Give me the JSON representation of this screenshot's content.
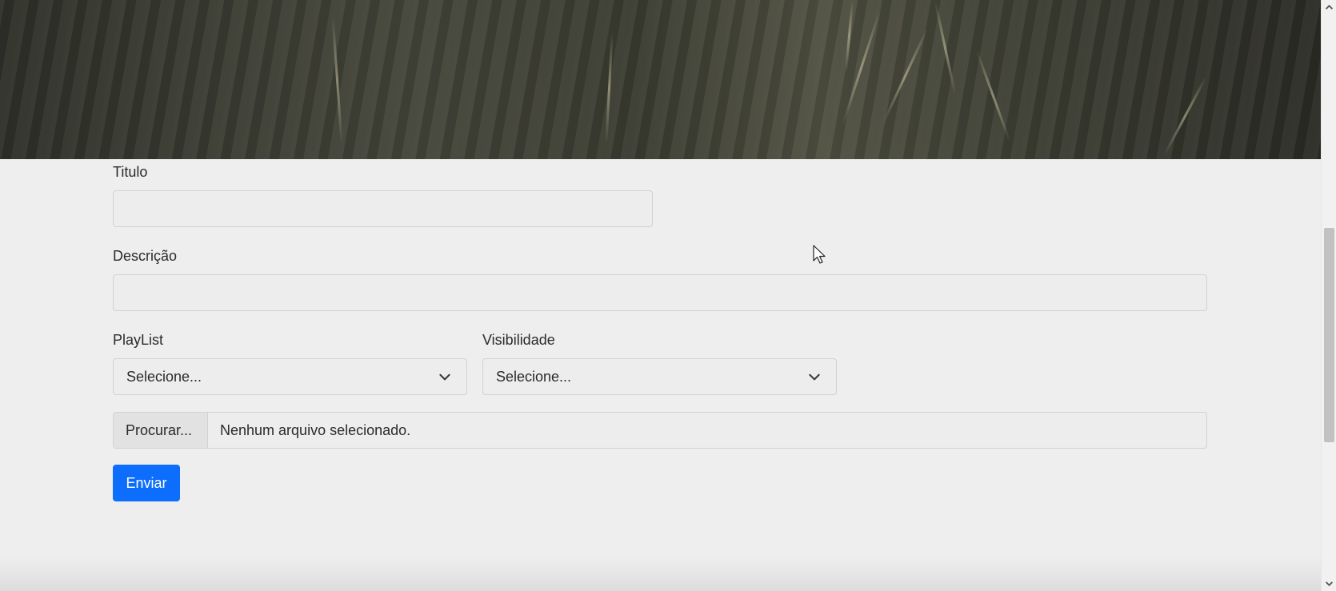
{
  "form": {
    "titulo": {
      "label": "Titulo",
      "value": ""
    },
    "descricao": {
      "label": "Descrição",
      "value": ""
    },
    "playlist": {
      "label": "PlayList",
      "selected": "Selecione..."
    },
    "visibilidade": {
      "label": "Visibilidade",
      "selected": "Selecione..."
    },
    "arquivo": {
      "browse_label": "Procurar...",
      "status": "Nenhum arquivo selecionado."
    },
    "submit_label": "Enviar"
  },
  "icons": {
    "select_arrow": "chevron-down-icon",
    "scroll_up": "scroll-up-arrow-icon",
    "scroll_down": "scroll-down-arrow-icon",
    "cursor": "mouse-pointer-icon"
  },
  "colors": {
    "page_background": "#eeeeee",
    "primary_button": "#0d6efd",
    "input_border": "#cfd2d5"
  }
}
